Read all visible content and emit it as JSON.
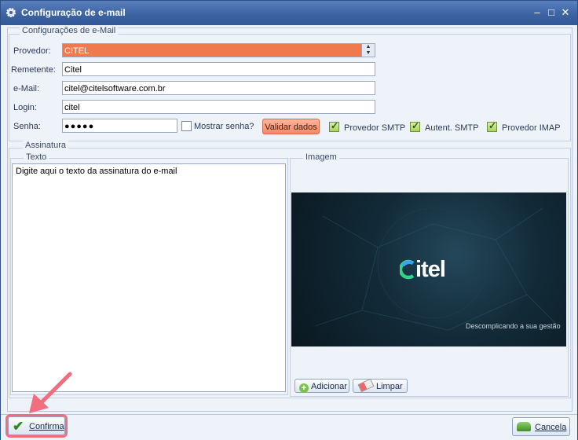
{
  "window": {
    "title": "Configuração de e-mail"
  },
  "email_group": {
    "legend": "Configurações de e-Mail",
    "provedor_label": "Provedor:",
    "provedor_value": "CITEL",
    "remetente_label": "Remetente:",
    "remetente_value": "Citel",
    "email_label": "e-Mail:",
    "email_value": "citel@citelsoftware.com.br",
    "login_label": "Login:",
    "login_value": "citel",
    "senha_label": "Senha:",
    "senha_value": "●●●●●",
    "mostrar_senha": {
      "label": "Mostrar senha?",
      "checked": false
    },
    "validar_label": "Validar dados",
    "options": [
      {
        "label": "Provedor SMTP",
        "checked": true
      },
      {
        "label": "Autent. SMTP",
        "checked": true
      },
      {
        "label": "Provedor IMAP",
        "checked": true
      }
    ]
  },
  "assinatura": {
    "legend": "Assinatura",
    "texto_legend": "Texto",
    "texto_value": "Digite aqui o texto da assinatura do e-mail",
    "imagem_legend": "Imagem",
    "logo_text": "itel",
    "tagline": "Descomplicando a sua gestão",
    "adicionar_label": "Adicionar",
    "limpar_label": "Limpar"
  },
  "footer": {
    "confirma_label": "Confirma",
    "cancela_label": "Cancela"
  },
  "colors": {
    "accent": "#f07a4e",
    "titlebar": "#3e63a3",
    "highlight": "#f26d7d"
  }
}
